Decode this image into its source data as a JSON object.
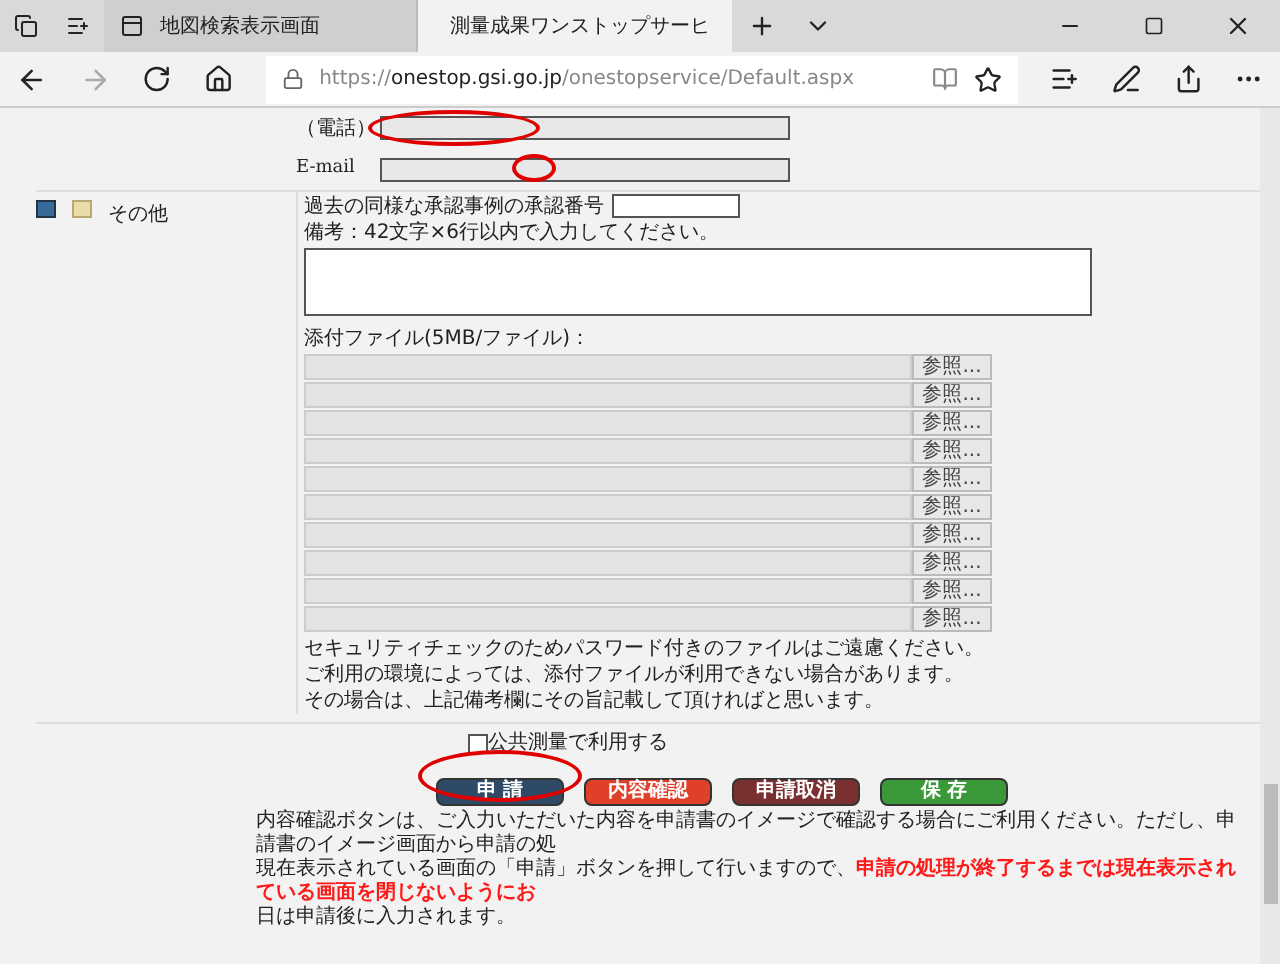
{
  "browser": {
    "tabs": [
      {
        "title": "地図検索表示画面",
        "selected": false
      },
      {
        "title": "測量成果ワンストップサーヒ",
        "selected": true
      }
    ],
    "address": {
      "scheme": "https://",
      "host": "onestop.gsi.go.jp",
      "path": "/onestopservice/Default.aspx"
    }
  },
  "contact": {
    "phone_label": "（電話）",
    "email_label": "E-mail",
    "phone_highlighted": true,
    "email_highlighted": true
  },
  "other_section": {
    "title": "その他",
    "approval_label": "過去の同様な承認事例の承認番号",
    "remarks_label": "備考：42文字×6行以内で入力してください。",
    "attachments_label": "添付ファイル(5MB/ファイル)：",
    "file_rows": [
      {
        "button": "参照..."
      },
      {
        "button": "参照..."
      },
      {
        "button": "参照..."
      },
      {
        "button": "参照..."
      },
      {
        "button": "参照..."
      },
      {
        "button": "参照..."
      },
      {
        "button": "参照..."
      },
      {
        "button": "参照..."
      },
      {
        "button": "参照..."
      },
      {
        "button": "参照..."
      }
    ],
    "notes": [
      "セキュリティチェックのためパスワード付きのファイルはご遠慮ください。",
      "ご利用の環境によっては、添付ファイルが利用できない場合があります。",
      "その場合は、上記備考欄にその旨記載して頂ければと思います。"
    ]
  },
  "public_survey": {
    "label": "公共測量で利用する",
    "checked": false
  },
  "buttons": [
    {
      "label": "申 請",
      "kind": "submit",
      "highlighted": true
    },
    {
      "label": "内容確認",
      "kind": "confirm",
      "highlighted": false
    },
    {
      "label": "申請取消",
      "kind": "cancel",
      "highlighted": false
    },
    {
      "label": "保 存",
      "kind": "save",
      "highlighted": false
    }
  ],
  "instructions": [
    [
      {
        "text": "内容確認ボタンは、ご入力いただいた内容を申請書のイメージで確認する場合にご利用ください。ただし、申請書のイメージ画面から申請の処",
        "red": false
      }
    ],
    [
      {
        "text": "現在表示されている画面の「申請」ボタンを押して行いますので、",
        "red": false
      },
      {
        "text": "申請の処理が終了するまでは現在表示されている画面を閉じないようにお",
        "red": true
      }
    ],
    [
      {
        "text": "日は申請後に入力されます。",
        "red": false
      }
    ]
  ]
}
